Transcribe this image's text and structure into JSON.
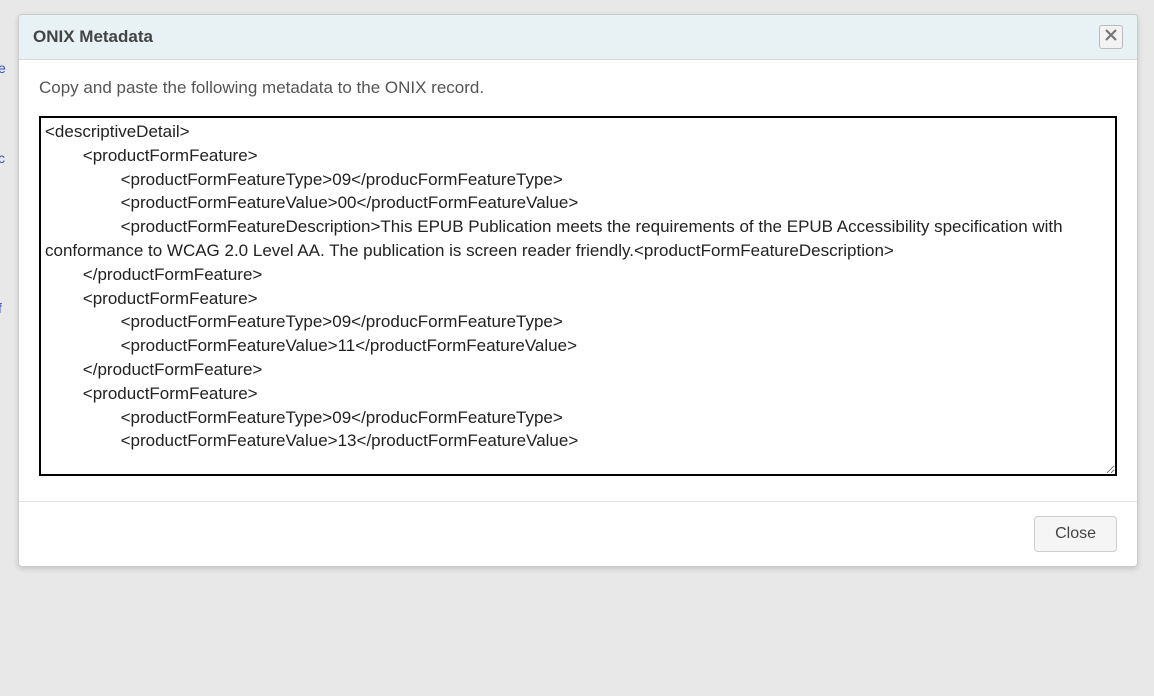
{
  "dialog": {
    "title": "ONIX Metadata",
    "instruction": "Copy and paste the following metadata to the ONIX record.",
    "textarea_value": "<descriptiveDetail>\n        <productFormFeature>\n                <productFormFeatureType>09</producFormFeatureType>\n                <productFormFeatureValue>00</productFormFeatureValue>\n                <productFormFeatureDescription>This EPUB Publication meets the requirements of the EPUB Accessibility specification with conformance to WCAG 2.0 Level AA. The publication is screen reader friendly.<productFormFeatureDescription>\n        </productFormFeature>\n        <productFormFeature>\n                <productFormFeatureType>09</producFormFeatureType>\n                <productFormFeatureValue>11</productFormFeatureValue>\n        </productFormFeature>\n        <productFormFeature>\n                <productFormFeatureType>09</producFormFeatureType>\n                <productFormFeatureValue>13</productFormFeatureValue>\n",
    "close_label": "Close"
  }
}
